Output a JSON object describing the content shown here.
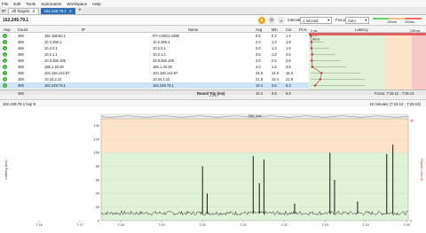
{
  "menu": [
    "File",
    "Edit",
    "Tools",
    "Summaries",
    "Workspace",
    "Help"
  ],
  "tabs": {
    "prefix": "IP:",
    "items": [
      {
        "label": "All Targets",
        "active": false
      },
      {
        "label": "162.249.79.1",
        "active": true
      }
    ],
    "new_tab": "+"
  },
  "toolbar": {
    "address": "162.249.79.1",
    "interval_label": "Interval",
    "interval_value": "1 second",
    "focus_label": "Focus",
    "focus_value": "Auto",
    "legend_low": "100ms",
    "legend_high": "200ms",
    "legend_zero": "0 ms",
    "legend_max": "128 ms"
  },
  "table": {
    "columns": [
      "Hop",
      "Count",
      "IP",
      "Name",
      "Avg",
      "Min",
      "Cur",
      "PL%",
      "Latency"
    ],
    "rows": [
      {
        "hop": "1",
        "count": "459",
        "ip": "192.168.50.1",
        "name": "RT-AX82U-4390",
        "avg": "0.6",
        "min": "0.3",
        "cur": "1.4",
        "pl": "",
        "lat": 0.6
      },
      {
        "hop": "2",
        "count": "459",
        "ip": "10.2.255.1",
        "name": "10.2.255.1",
        "avg": "2.0",
        "min": "1.3",
        "cur": "1.9",
        "pl": "",
        "lat": 2.0
      },
      {
        "hop": "3",
        "count": "459",
        "ip": "10.2.0.1",
        "name": "10.2.0.1",
        "avg": "2.0",
        "min": "1.3",
        "cur": "1.9",
        "pl": "",
        "lat": 2.0
      },
      {
        "hop": "4",
        "count": "459",
        "ip": "10.2.1.1",
        "name": "10.2.1.1",
        "avg": "3.5",
        "min": "1.8",
        "cur": "2.5",
        "pl": "",
        "lat": 3.5
      },
      {
        "hop": "5",
        "count": "459",
        "ip": "10.0.255.105",
        "name": "10.0.255.105",
        "avg": "2.8",
        "min": "2.5",
        "cur": "2.6",
        "pl": "",
        "lat": 2.8
      },
      {
        "hop": "6",
        "count": "459",
        "ip": "185.1.48.29",
        "name": "185.1.48.29",
        "avg": "4.0",
        "min": "1.2",
        "cur": "3.8",
        "pl": "",
        "lat": 4.0
      },
      {
        "hop": "7",
        "count": "459",
        "ip": "104.160.142.67",
        "name": "104.160.142.67",
        "avg": "24.5",
        "min": "14.0",
        "cur": "16.3",
        "pl": "",
        "lat": 24.5
      },
      {
        "hop": "8",
        "count": "459",
        "ip": "10.34.2.10",
        "name": "10.34.2.10",
        "avg": "21.8",
        "min": "13.4",
        "cur": "21.8",
        "pl": "",
        "lat": 21.8
      },
      {
        "hop": "9",
        "count": "459",
        "ip": "162.249.79.1",
        "name": "162.249.79.1",
        "avg": "10.4",
        "min": "3.6",
        "cur": "6.3",
        "pl": "",
        "lat": 10.4
      }
    ],
    "first_pl": "99.8",
    "roundtrip": {
      "count": "459",
      "label": "Round Trip (ms)",
      "avg": "10.4",
      "min": "3.6",
      "cur": "6.3",
      "focus": "Focus: 7:15:12 - 7:25:13"
    }
  },
  "graph": {
    "title": "162.249.79.1 hop 9",
    "range": "10 minutes (7:15:12 - 7:25:13)",
    "ylabel": "Latency (ms)",
    "ylabel_right": "Packet Loss %",
    "jitter_label": "Jitter (ms)",
    "y_ticks": [
      "140",
      "120",
      "100",
      "80",
      "60",
      "40",
      "20",
      "0"
    ],
    "y_ticks_right": [
      "30",
      "0"
    ],
    "x_ticks": [
      "7:16",
      "7:17",
      "7:18",
      "7:19",
      "7:20",
      "7:21",
      "7:22",
      "7:23",
      "7:24",
      "7:25"
    ],
    "spikes": [
      {
        "t": 0.33,
        "v": 80
      },
      {
        "t": 0.345,
        "v": 40
      },
      {
        "t": 0.495,
        "v": 95
      },
      {
        "t": 0.515,
        "v": 55
      },
      {
        "t": 0.53,
        "v": 90
      },
      {
        "t": 0.63,
        "v": 25
      },
      {
        "t": 0.745,
        "v": 100
      },
      {
        "t": 0.76,
        "v": 60
      },
      {
        "t": 0.835,
        "v": 28
      },
      {
        "t": 0.93,
        "v": 98
      },
      {
        "t": 0.95,
        "v": 112
      }
    ],
    "colors": {
      "green": "#dff1d6",
      "orange": "#fde4c8",
      "red": "#f6c7c7",
      "line": "#111111",
      "spike": "#000000"
    }
  }
}
